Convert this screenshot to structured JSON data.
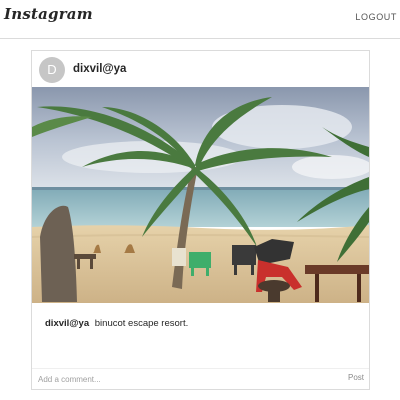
{
  "app": {
    "logo": "Instagram",
    "logout_label": "LOGOUT"
  },
  "post": {
    "avatar_letter": "D",
    "username": "dixvil@ya",
    "caption_user": "dixvil@ya",
    "caption_text": "binucot escape resort."
  },
  "comment": {
    "placeholder": "Add a comment...",
    "post_label": "Post"
  }
}
